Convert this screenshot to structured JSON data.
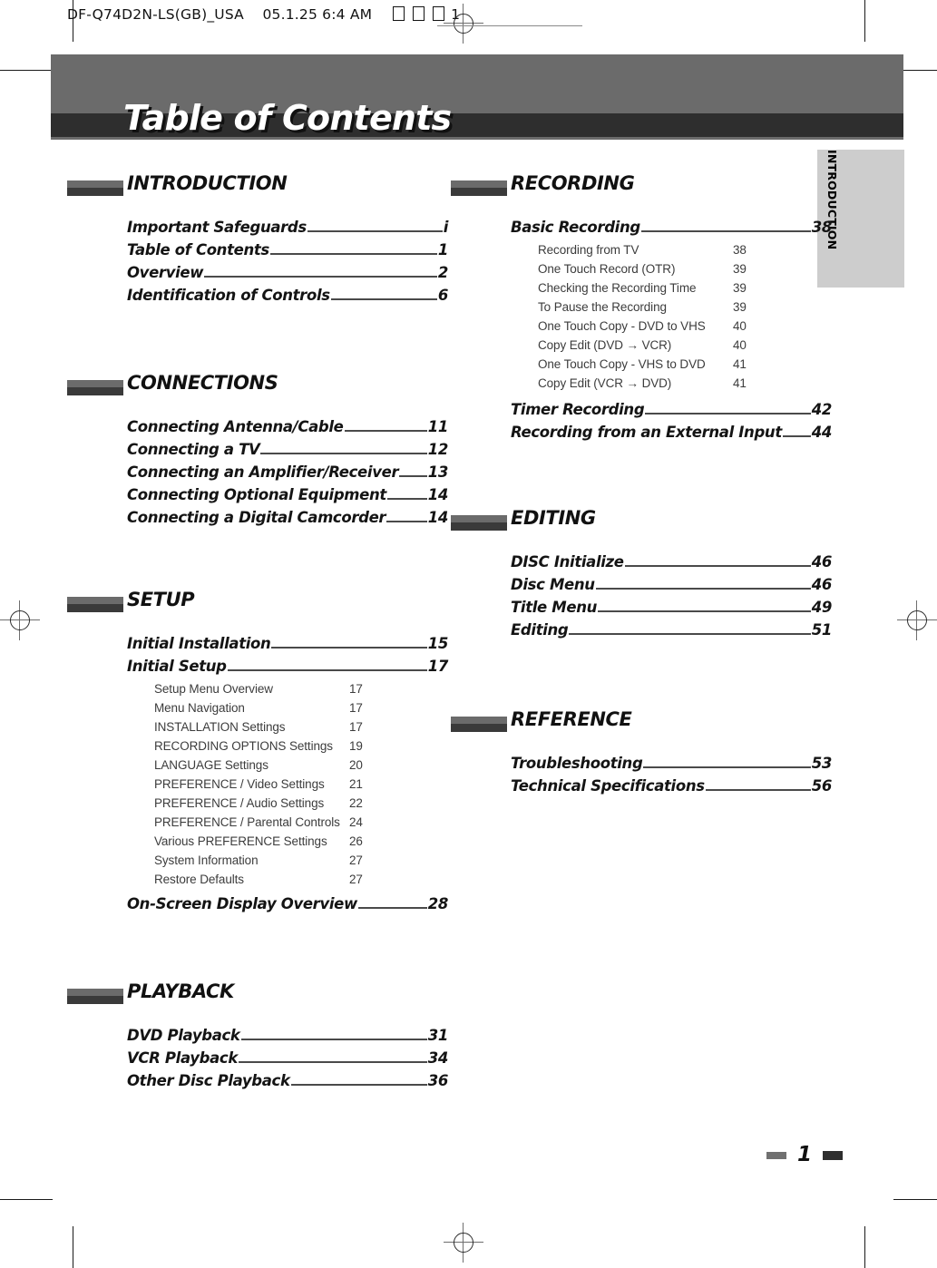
{
  "print_header": {
    "file_label": "DF-Q74D2N-LS(GB)_USA",
    "timestamp": "05.1.25 6:4 AM",
    "page_marker": "1"
  },
  "banner": {
    "title": "Table of Contents",
    "bg_color": "#6b6b6b",
    "stripe_color": "#2e2e2e",
    "text_color": "#ffffff"
  },
  "side_tab": {
    "label": "INTRODUCTION",
    "bg_color": "#cdcdcd"
  },
  "footer": {
    "page_number": "1"
  },
  "left_column": {
    "sections": [
      {
        "title": "INTRODUCTION",
        "entries": [
          {
            "label": "Important Safeguards",
            "page": "i"
          },
          {
            "label": "Table of Contents",
            "page": "1"
          },
          {
            "label": "Overview",
            "page": "2"
          },
          {
            "label": "Identification of Controls",
            "page": "6"
          }
        ]
      },
      {
        "title": "CONNECTIONS",
        "entries": [
          {
            "label": "Connecting Antenna/Cable",
            "page": "11"
          },
          {
            "label": "Connecting a TV",
            "page": "12"
          },
          {
            "label": "Connecting an Amplifier/Receiver",
            "page": "13"
          },
          {
            "label": "Connecting Optional Equipment",
            "page": "14"
          },
          {
            "label": "Connecting a Digital Camcorder",
            "page": "14"
          }
        ]
      },
      {
        "title": "SETUP",
        "entries": [
          {
            "label": "Initial Installation",
            "page": "15"
          },
          {
            "label": "Initial Setup",
            "page": "17"
          }
        ],
        "subentries": [
          {
            "label": "Setup Menu Overview",
            "page": "17"
          },
          {
            "label": "Menu Navigation",
            "page": "17"
          },
          {
            "label": "INSTALLATION Settings",
            "page": "17"
          },
          {
            "label": "RECORDING OPTIONS Settings",
            "page": "19"
          },
          {
            "label": "LANGUAGE Settings",
            "page": "20"
          },
          {
            "label": "PREFERENCE / Video Settings",
            "page": "21"
          },
          {
            "label": "PREFERENCE / Audio Settings",
            "page": "22"
          },
          {
            "label": "PREFERENCE / Parental Controls",
            "page": "24"
          },
          {
            "label": "Various PREFERENCE Settings",
            "page": "26"
          },
          {
            "label": "System Information",
            "page": "27"
          },
          {
            "label": "Restore Defaults",
            "page": "27"
          }
        ],
        "entries_after": [
          {
            "label": "On-Screen Display Overview",
            "page": "28"
          }
        ]
      },
      {
        "title": "PLAYBACK",
        "entries": [
          {
            "label": "DVD Playback",
            "page": "31"
          },
          {
            "label": "VCR Playback",
            "page": "34"
          },
          {
            "label": "Other Disc Playback",
            "page": "36"
          }
        ]
      }
    ]
  },
  "right_column": {
    "sections": [
      {
        "title": "RECORDING",
        "entries": [
          {
            "label": "Basic Recording",
            "page": "38"
          }
        ],
        "subentries": [
          {
            "label": "Recording from TV",
            "page": "38"
          },
          {
            "label": "One Touch Record (OTR)",
            "page": "39"
          },
          {
            "label": "Checking the Recording Time",
            "page": "39"
          },
          {
            "label": "To Pause the Recording",
            "page": "39"
          },
          {
            "label": "One Touch Copy - DVD to VHS",
            "page": "40"
          },
          {
            "label": "Copy Edit (DVD → VCR)",
            "page": "40"
          },
          {
            "label": "One Touch Copy - VHS to DVD",
            "page": "41"
          },
          {
            "label": "Copy Edit (VCR → DVD)",
            "page": "41"
          }
        ],
        "entries_after": [
          {
            "label": "Timer Recording",
            "page": "42"
          },
          {
            "label": "Recording from an External Input",
            "page": "44"
          }
        ]
      },
      {
        "title": "EDITING",
        "entries": [
          {
            "label": "DISC Initialize",
            "page": "46"
          },
          {
            "label": "Disc Menu",
            "page": "46"
          },
          {
            "label": "Title Menu",
            "page": "49"
          },
          {
            "label": "Editing",
            "page": "51"
          }
        ]
      },
      {
        "title": "REFERENCE",
        "entries": [
          {
            "label": "Troubleshooting",
            "page": "53"
          },
          {
            "label": "Technical Specifications",
            "page": "56"
          }
        ]
      }
    ]
  }
}
